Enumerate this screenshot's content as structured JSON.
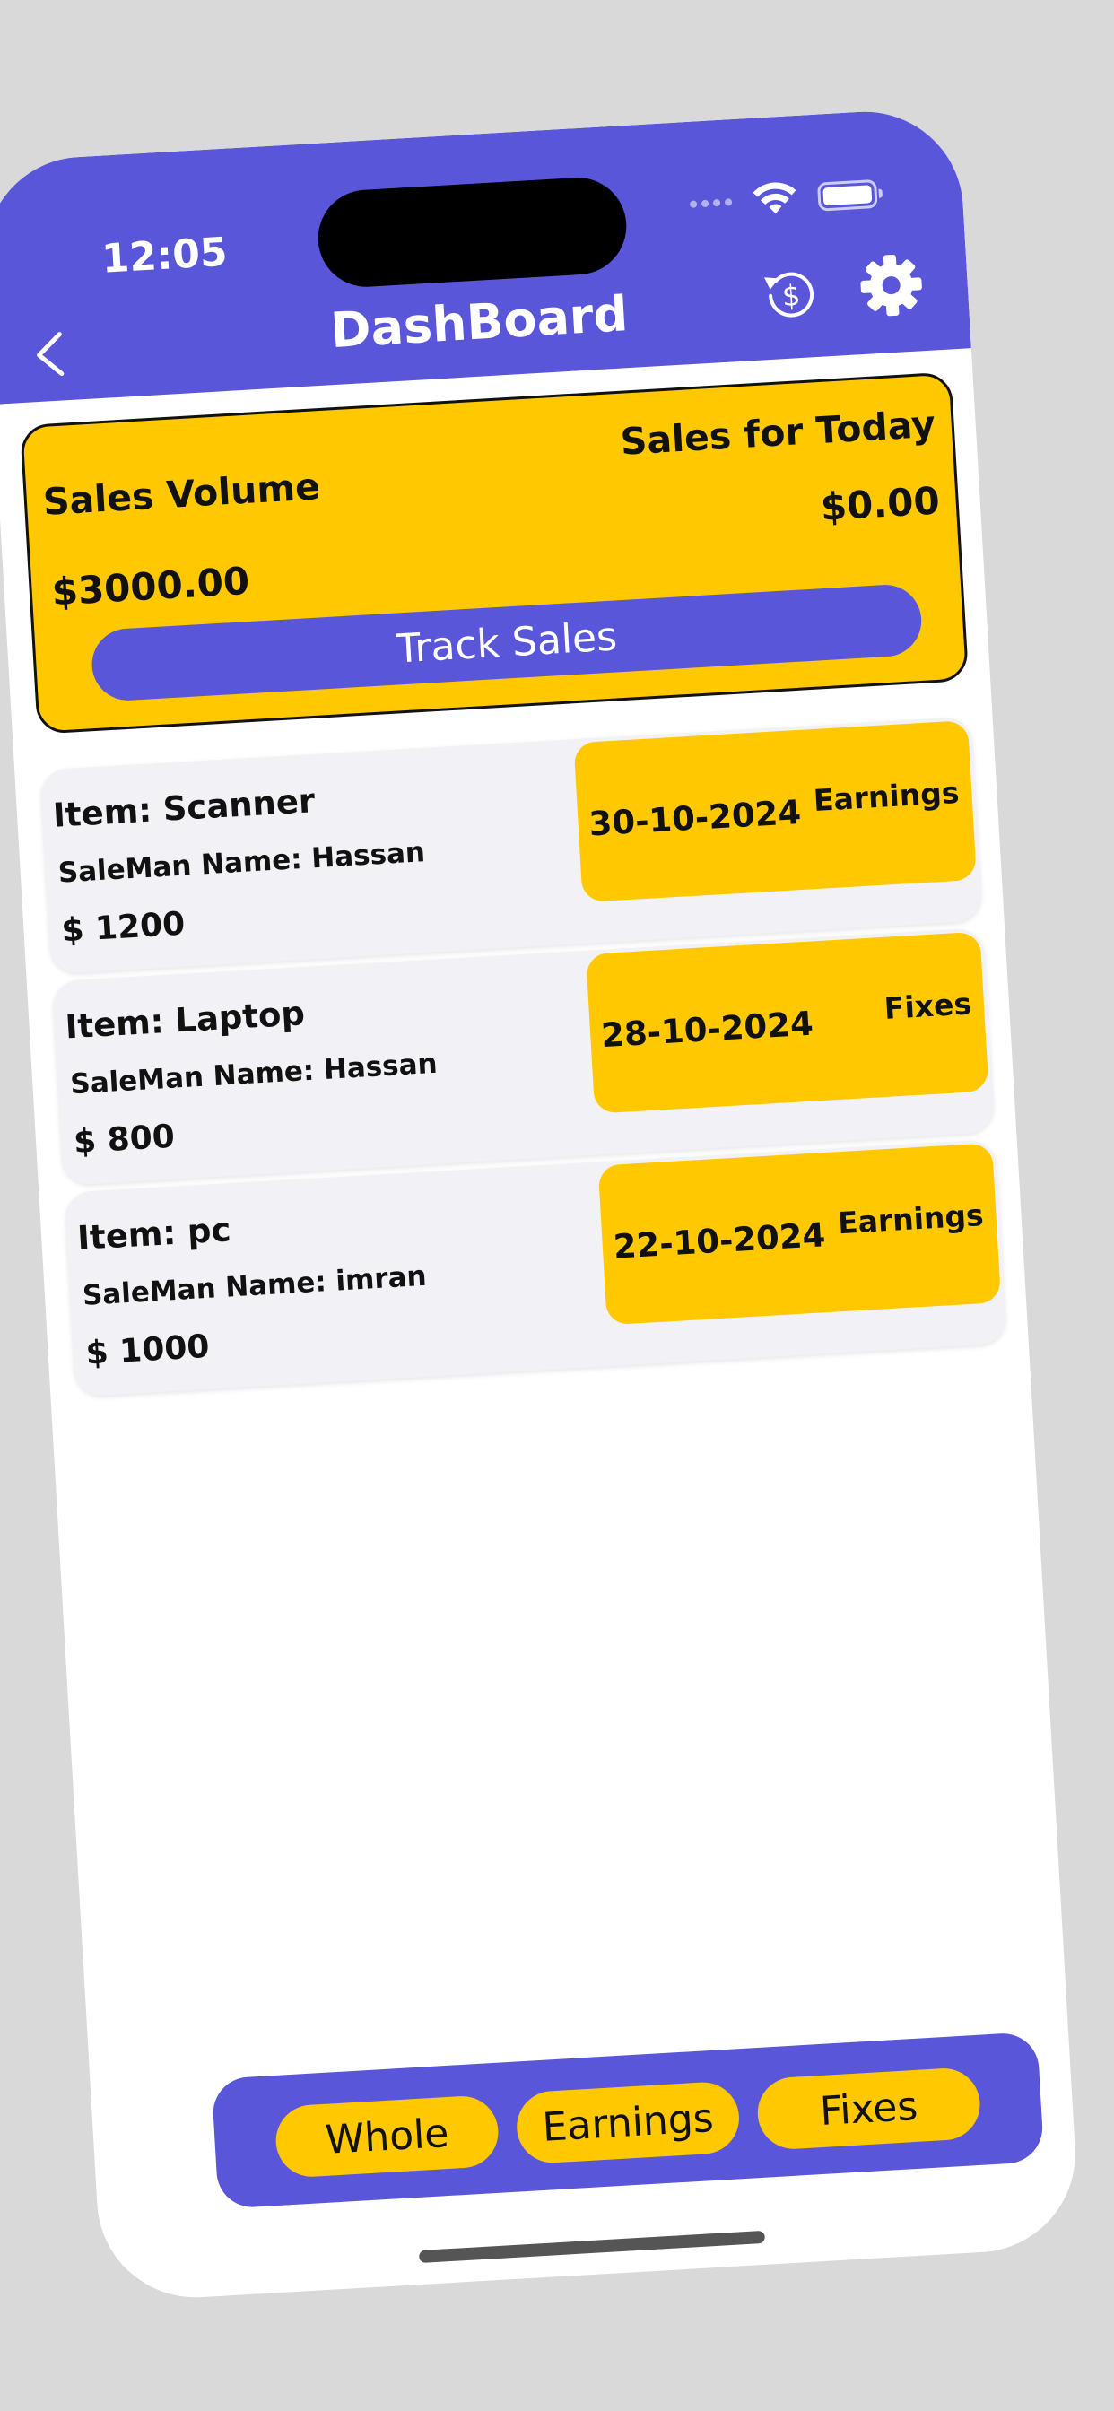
{
  "status_bar": {
    "time": "12:05"
  },
  "header": {
    "title": "DashBoard"
  },
  "summary": {
    "sales_volume_label": "Sales Volume",
    "sales_volume_value": "$3000.00",
    "sales_today_label": "Sales for Today",
    "sales_today_value": "$0.00",
    "track_button": "Track Sales"
  },
  "sales": [
    {
      "item": "Item: Scanner",
      "salesman": "SaleMan Name: Hassan",
      "amount": "$ 1200",
      "date": "30-10-2024",
      "type": "Earnings"
    },
    {
      "item": "Item: Laptop",
      "salesman": "SaleMan Name: Hassan",
      "amount": "$ 800",
      "date": "28-10-2024",
      "type": "Fixes"
    },
    {
      "item": "Item: pc",
      "salesman": "SaleMan Name: imran",
      "amount": "$ 1000",
      "date": "22-10-2024",
      "type": "Earnings"
    }
  ],
  "filters": [
    "Whole",
    "Earnings",
    "Fixes"
  ],
  "colors": {
    "primary": "#5a56d9",
    "accent": "#ffc800",
    "card": "#f1f1f6"
  },
  "icons": {
    "back": "chevron-left-icon",
    "history": "dollar-history-icon",
    "settings": "gear-icon"
  }
}
